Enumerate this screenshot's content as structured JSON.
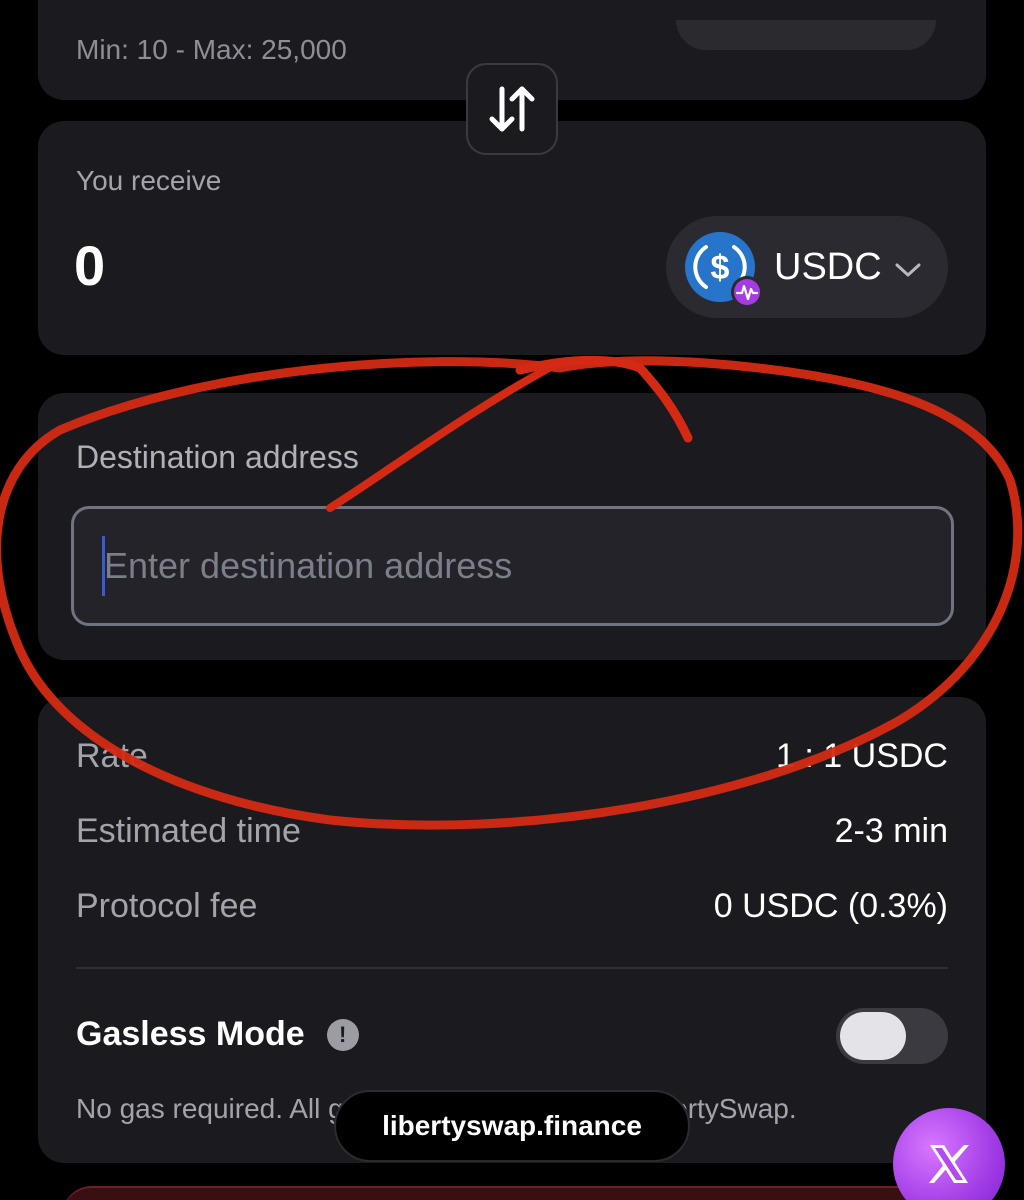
{
  "swap": {
    "min_max_text": "Min: 10 - Max: 25,000",
    "swap_icon": "swap-arrows-icon"
  },
  "receive": {
    "label": "You receive",
    "amount": "0",
    "token": {
      "symbol": "USDC",
      "icon": "usdc-coin-icon",
      "chain_badge_icon": "chain-badge-icon",
      "dropdown_icon": "chevron-down-icon"
    }
  },
  "destination": {
    "label": "Destination address",
    "placeholder": "Enter destination address",
    "value": ""
  },
  "details": {
    "rows": [
      {
        "label": "Rate",
        "value": "1 : 1 USDC"
      },
      {
        "label": "Estimated time",
        "value": "2-3 min"
      },
      {
        "label": "Protocol fee",
        "value": "0 USDC (0.3%)"
      }
    ]
  },
  "gasless": {
    "title": "Gasless Mode",
    "info_icon_glyph": "!",
    "enabled": false,
    "note": "No gas required. All gas fees are covered by LibertySwap."
  },
  "browser": {
    "url": "libertyswap.finance"
  },
  "floating_button": {
    "icon": "x-logo-icon"
  },
  "colors": {
    "background": "#000000",
    "card": "#1b1b1f",
    "usdc_blue": "#2775ca",
    "annotation_red": "#d42a14",
    "x_button_purple": "#b34af0"
  }
}
